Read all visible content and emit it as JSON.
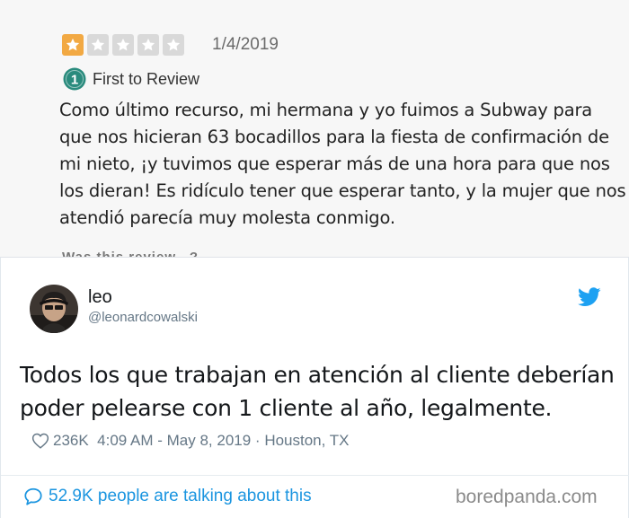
{
  "review": {
    "rating": 1,
    "max_rating": 5,
    "date": "1/4/2019",
    "badge_number": "1",
    "badge_label": "First to Review",
    "text": "Como último recurso, mi hermana y yo fuimos a Subway para que nos hicieran 63 bocadillos para la fiesta de confirmación de mi nieto, ¡y tuvimos que esperar más de una hora para que nos los dieran! Es ridículo tener que esperar tanto, y la mujer que nos atendió parecía muy molesta conmigo.",
    "cut_text": "Was this review...?"
  },
  "tweet": {
    "display_name": "leo",
    "handle": "@leonardcowalski",
    "text": "Todos los que trabajan en atención al cliente deberían poder pelearse con 1 cliente al año, legalmente.",
    "likes": "236K",
    "time": "4:09 AM",
    "date": "May 8, 2019",
    "location": "Houston, TX",
    "talking": "52.9K people are talking about this"
  },
  "watermark": "boredpanda.com",
  "colors": {
    "star_filled": "#f2a943",
    "star_empty": "#d9d9d9",
    "badge": "#2a8b7d",
    "twitter_blue": "#1da1f2",
    "link_blue": "#1b95e0"
  }
}
